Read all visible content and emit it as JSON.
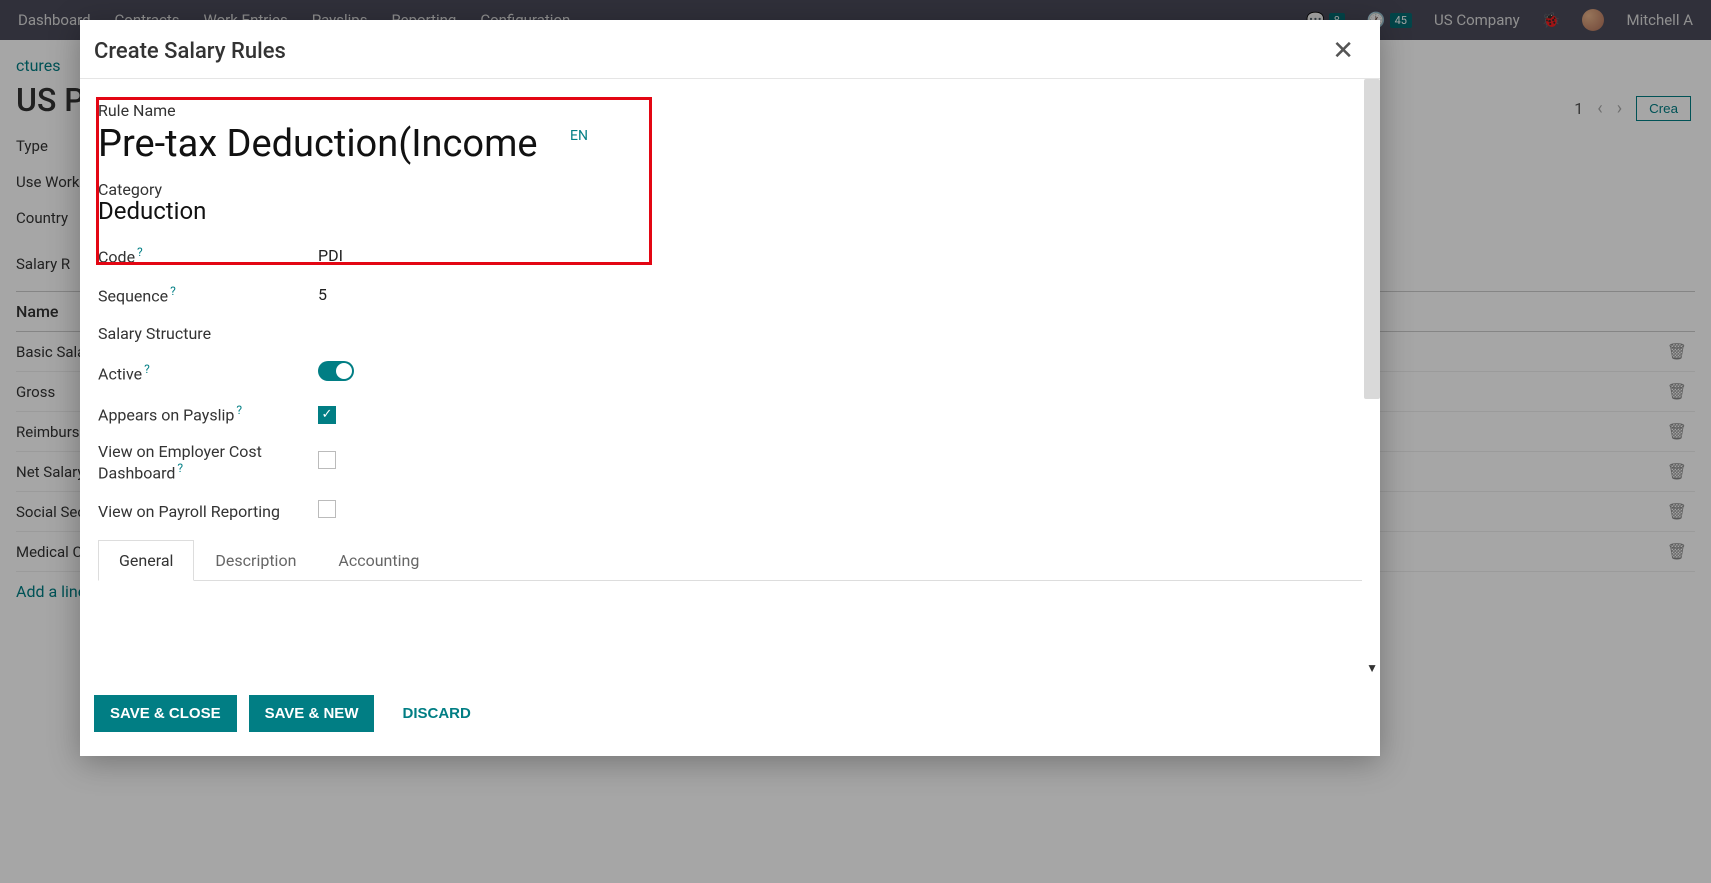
{
  "topnav": {
    "items": [
      "Dashboard",
      "Contracts",
      "Work Entries",
      "Payslips",
      "Reporting",
      "Configuration"
    ],
    "messages_badge": "8",
    "activities_badge": "45",
    "company": "US Company",
    "user": "Mitchell A"
  },
  "bg": {
    "breadcrumb": "ctures",
    "title": "US P",
    "labels": {
      "type": "Type",
      "usework": "Use Work",
      "country": "Country"
    },
    "tabs": {
      "salary": "Salary R"
    },
    "col_name": "Name",
    "rows": [
      "Basic Sala",
      "Gross",
      "Reimburse",
      "Net Salary",
      "Social Sec",
      "Medical C"
    ],
    "add_line": "Add a line",
    "pager": "1",
    "create": "Crea"
  },
  "modal": {
    "title": "Create Salary Rules",
    "rule_name_label": "Rule Name",
    "rule_name_value": "Pre-tax Deduction(Income",
    "lang_tag": "EN",
    "category_label": "Category",
    "category_value": "Deduction",
    "code_label": "Code",
    "code_value": "PDI",
    "sequence_label": "Sequence",
    "sequence_value": "5",
    "salary_structure_label": "Salary Structure",
    "active_label": "Active",
    "appears_label": "Appears on Payslip",
    "employer_cost_label": "View on Employer Cost Dashboard",
    "payroll_report_label": "View on Payroll Reporting",
    "tabs": {
      "general": "General",
      "description": "Description",
      "accounting": "Accounting"
    },
    "footer": {
      "save_close": "SAVE & CLOSE",
      "save_new": "SAVE & NEW",
      "discard": "DISCARD"
    }
  }
}
